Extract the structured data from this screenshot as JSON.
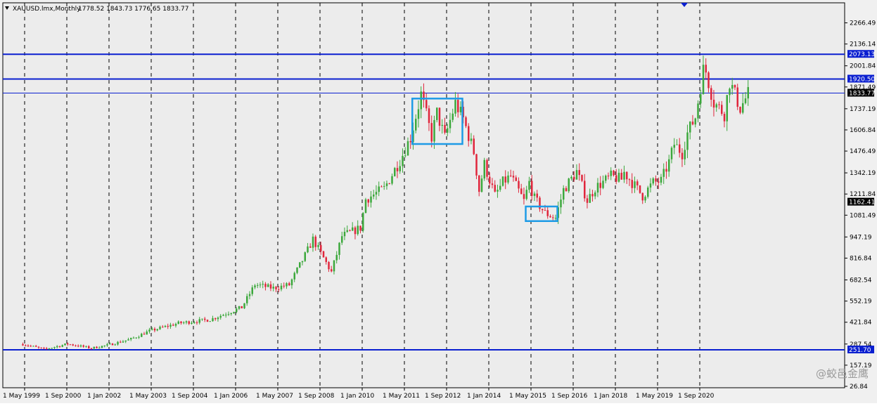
{
  "header": {
    "title": "XAUUSD.lmx,Monthly",
    "ohlc": "1778.52 1843.73 1776.65 1833.77"
  },
  "watermark": "@蛟邑金鹰",
  "colors": {
    "background": "#f0f0f0",
    "plot_background": "#ececec",
    "bull_candle": "#3ca83c",
    "bear_candle": "#e0263c",
    "level_line": "#0a1fd0",
    "highlight_box": "#1e9be6",
    "current_price_line": "#0a1fd0"
  },
  "chart_data": {
    "type": "candlestick",
    "title": "XAUUSD.lmx,Monthly",
    "y_scale": "linear",
    "ylim": [
      26.84,
      2390
    ],
    "y_ticks": [
      "2266.49",
      "2136.14",
      "2001.84",
      "1871.49",
      "1737.19",
      "1606.84",
      "1476.49",
      "1342.19",
      "1211.84",
      "1081.49",
      "947.19",
      "816.84",
      "682.54",
      "552.19",
      "421.84",
      "287.54",
      "157.19",
      "26.84"
    ],
    "x_ticks": [
      "1 May 1999",
      "1 Sep 2000",
      "1 Jan 2002",
      "1 May 2003",
      "1 Sep 2004",
      "1 Jan 2006",
      "1 May 2007",
      "1 Sep 2008",
      "1 Jan 2010",
      "1 May 2011",
      "1 Sep 2012",
      "1 Jan 2014",
      "1 May 2015",
      "1 Sep 2016",
      "1 Jan 2018",
      "1 May 2019",
      "1 Sep 2020"
    ],
    "grid": "vertical dashed",
    "price_levels": [
      {
        "label": "2073.13",
        "value": 2073.13
      },
      {
        "label": "1920.50",
        "value": 1920.5
      },
      {
        "label": "251.70",
        "value": 251.7
      }
    ],
    "current_price": {
      "label": "1833.77",
      "value": 1833.77
    },
    "price_marker": {
      "label": "1162.41",
      "value": 1162.41
    },
    "highlight_boxes": [
      {
        "from": "2011-05",
        "to": "2012-12",
        "low": 1520,
        "high": 1800
      },
      {
        "from": "2014-12",
        "to": "2015-12",
        "low": 1045,
        "high": 1135
      }
    ],
    "anchors": [
      [
        "1999-01",
        287
      ],
      [
        "1999-09",
        255
      ],
      [
        "2000-06",
        288
      ],
      [
        "2001-03",
        262
      ],
      [
        "2001-09",
        280
      ],
      [
        "2002-06",
        318
      ],
      [
        "2003-01",
        368
      ],
      [
        "2003-12",
        416
      ],
      [
        "2004-12",
        438
      ],
      [
        "2005-12",
        513
      ],
      [
        "2006-05",
        654
      ],
      [
        "2006-12",
        632
      ],
      [
        "2007-06",
        652
      ],
      [
        "2007-12",
        834
      ],
      [
        "2008-03",
        933
      ],
      [
        "2008-10",
        730
      ],
      [
        "2009-02",
        952
      ],
      [
        "2009-09",
        1003
      ],
      [
        "2009-11",
        1180
      ],
      [
        "2010-06",
        1245
      ],
      [
        "2010-12",
        1420
      ],
      [
        "2011-04",
        1560
      ],
      [
        "2011-08",
        1825
      ],
      [
        "2011-12",
        1565
      ],
      [
        "2012-02",
        1712
      ],
      [
        "2012-05",
        1558
      ],
      [
        "2012-09",
        1772
      ],
      [
        "2012-12",
        1675
      ],
      [
        "2013-04",
        1470
      ],
      [
        "2013-06",
        1234
      ],
      [
        "2013-08",
        1395
      ],
      [
        "2013-12",
        1202
      ],
      [
        "2014-03",
        1284
      ],
      [
        "2014-06",
        1322
      ],
      [
        "2014-11",
        1168
      ],
      [
        "2015-01",
        1283
      ],
      [
        "2015-03",
        1183
      ],
      [
        "2015-07",
        1095
      ],
      [
        "2015-11",
        1064
      ],
      [
        "2016-02",
        1238
      ],
      [
        "2016-07",
        1350
      ],
      [
        "2016-11",
        1172
      ],
      [
        "2017-02",
        1250
      ],
      [
        "2017-08",
        1320
      ],
      [
        "2017-12",
        1302
      ],
      [
        "2018-01",
        1345
      ],
      [
        "2018-08",
        1200
      ],
      [
        "2018-12",
        1282
      ],
      [
        "2019-03",
        1292
      ],
      [
        "2019-06",
        1409
      ],
      [
        "2019-08",
        1520
      ],
      [
        "2019-11",
        1464
      ],
      [
        "2020-01",
        1587
      ],
      [
        "2020-04",
        1686
      ],
      [
        "2020-07",
        1975
      ],
      [
        "2020-08",
        1967
      ],
      [
        "2020-11",
        1776
      ],
      [
        "2021-03",
        1707
      ],
      [
        "2021-05",
        1905
      ],
      [
        "2021-09",
        1742
      ],
      [
        "2021-12",
        1828
      ]
    ]
  },
  "axes": {
    "date_start": "1998-06",
    "months_per_tick": 16
  }
}
